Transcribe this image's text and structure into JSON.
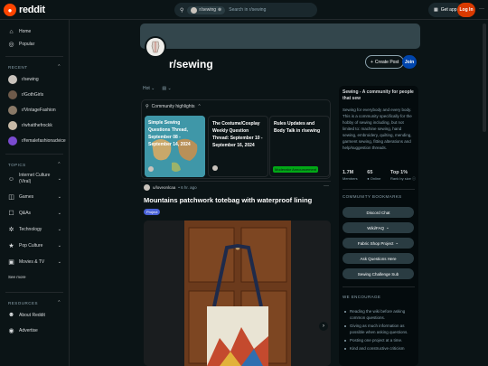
{
  "header": {
    "brand": "reddit",
    "search_chip": "r/sewing",
    "search_placeholder": "Search in r/sewing",
    "get_app": "Get app",
    "login": "Log In",
    "more": "···"
  },
  "sidebar": {
    "nav": [
      {
        "label": "Home",
        "icon": "home-icon"
      },
      {
        "label": "Popular",
        "icon": "popular-icon"
      }
    ],
    "recent_head": "RECENT",
    "recent": [
      {
        "label": "r/sewing",
        "color": "#c9c3bc"
      },
      {
        "label": "r/GothGirls",
        "color": "#6e5a4a"
      },
      {
        "label": "r/VintageFashion",
        "color": "#8a7a68"
      },
      {
        "label": "r/whatthefrockk",
        "color": "#c7b9a6"
      },
      {
        "label": "r/femalefashionadvice",
        "color": "#7a4bd0"
      }
    ],
    "topics_head": "TOPICS",
    "topics": [
      {
        "label": "Internet Culture (Viral)",
        "icon": "internet-culture-icon"
      },
      {
        "label": "Games",
        "icon": "games-icon"
      },
      {
        "label": "Q&As",
        "icon": "qa-icon"
      },
      {
        "label": "Technology",
        "icon": "technology-icon"
      },
      {
        "label": "Pop Culture",
        "icon": "pop-culture-icon"
      },
      {
        "label": "Movies & TV",
        "icon": "movies-tv-icon"
      }
    ],
    "see_more": "See more",
    "resources_head": "RESOURCES",
    "resources": [
      {
        "label": "About Reddit",
        "icon": "about-icon"
      },
      {
        "label": "Advertise",
        "icon": "advertise-icon"
      }
    ]
  },
  "subreddit": {
    "name": "r/sewing",
    "create_post": "Create Post",
    "join": "Join"
  },
  "sort": {
    "label": "Hot"
  },
  "highlights": {
    "title": "Community highlights",
    "cards": [
      {
        "title": "Simple Sewing Questions Thread, September 08 - September 14, 2024"
      },
      {
        "title": "The Costume/Cosplay Weekly Question Thread: September 10 - September 16, 2024"
      },
      {
        "title": "Rules Updates and Body Talk in r/sewing",
        "badge": "Moderator Announcement"
      }
    ]
  },
  "post": {
    "author": "u/loveonlcaa",
    "time": "• 6 hr. ago",
    "title": "Mountains patchwork totebag with waterproof lining",
    "flair": "Project"
  },
  "about": {
    "title": "Sewing - A community for people that sew",
    "description": "Sewing for everybody and every body. This is a community specifically for the hobby of sewing including, but not limited to: machine sewing, hand sewing, embroidery, quilting, mending, garment sewing, fitting alterations and help/suggestion threads.",
    "stats": [
      {
        "value": "1.7M",
        "label": "Members"
      },
      {
        "value": "65",
        "label": "● Online"
      },
      {
        "value": "Top 1%",
        "label": "Rank by size ⓘ"
      }
    ],
    "bookmarks_head": "COMMUNITY BOOKMARKS",
    "bookmarks": [
      {
        "label": "Discord Chat",
        "dropdown": false
      },
      {
        "label": "Wiki/FAQ",
        "dropdown": true
      },
      {
        "label": "Fabric Shop Project",
        "dropdown": true
      },
      {
        "label": "Ask Questions Here",
        "dropdown": false
      },
      {
        "label": "Sewing Challenge Sub",
        "dropdown": false
      }
    ],
    "encourage_head": "WE ENCOURAGE",
    "encourage": [
      "Reading the wiki before asking common questions.",
      "Giving as much information as possible when asking questions.",
      "Posting one project at a time.",
      "Kind and constructive criticism"
    ]
  },
  "colors": {
    "bg": "#0b1416",
    "accent": "#ff4500",
    "join": "#0045ac",
    "flair": "#4a62d8",
    "online": "#01a816"
  }
}
